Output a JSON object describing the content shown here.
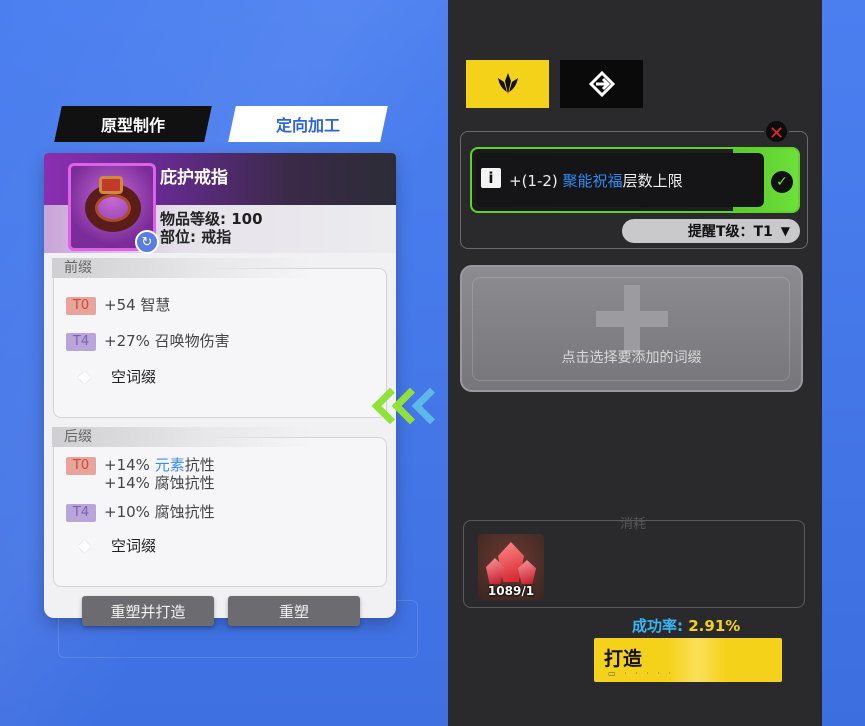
{
  "tabs": {
    "prototype": "原型制作",
    "directed": "定向加工"
  },
  "item": {
    "name": "庇护戒指",
    "level": "物品等级: 100",
    "slot": "部位: 戒指",
    "icon": "ring-icon"
  },
  "prefix": {
    "label": "前缀",
    "affixes": [
      {
        "tier": "T0",
        "text": "+54 智慧"
      },
      {
        "tier": "T4",
        "text": "+27% 召唤物伤害"
      }
    ],
    "empty": "空词缀"
  },
  "suffix": {
    "label": "后缀",
    "affix1": {
      "tier": "T0",
      "line1_prefix": "+14% ",
      "line1_hl": "元素",
      "line1_suffix": "抗性",
      "line2": "+14% 腐蚀抗性"
    },
    "affix2": {
      "tier": "T4",
      "text": "+10% 腐蚀抗性"
    },
    "empty": "空词缀"
  },
  "buttons": {
    "reforge_and_forge": "重塑并打造",
    "reforge": "重塑",
    "forge": "打造"
  },
  "selected_affix": {
    "range": "+(1-2) ",
    "highlight": "聚能祝福",
    "rest": "层数上限"
  },
  "awaken": {
    "label": "提醒T级：T1"
  },
  "add_affix": {
    "label": "点击选择要添加的词缀"
  },
  "consume": {
    "label": "消耗",
    "material_count": "1089/1"
  },
  "success": {
    "label": "成功率",
    "sep": ": ",
    "value": "2.91%"
  },
  "colors": {
    "accent_yellow": "#f5d21a",
    "accent_green": "#6ee03a",
    "highlight_blue": "#2e8cf0",
    "background_blue": "#4a7be8"
  }
}
